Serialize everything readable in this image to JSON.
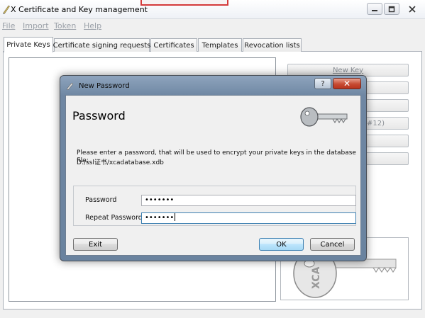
{
  "window": {
    "title": "X Certificate and Key management"
  },
  "menu": [
    {
      "label": "File"
    },
    {
      "label": "Import"
    },
    {
      "label": "Token"
    },
    {
      "label": "Help"
    }
  ],
  "tabs": [
    {
      "label": "Private Keys",
      "active": true
    },
    {
      "label": "Certificate signing requests"
    },
    {
      "label": "Certificates"
    },
    {
      "label": "Templates"
    },
    {
      "label": "Revocation lists"
    }
  ],
  "side_panel": {
    "new_key_label": "New Key",
    "obscured_text": "#12)"
  },
  "dialog": {
    "title": "New Password",
    "help_label": "?",
    "close_label": "✕",
    "heading": "Password",
    "description": "Please enter a password, that will be used to encrypt your private keys in the database file:",
    "file_path": "D:/ssl证书/xcadatabase.xdb",
    "password_label": "Password",
    "password_value": "•••••••",
    "repeat_label": "Repeat Password",
    "repeat_value": "•••••••",
    "exit_label": "Exit",
    "ok_label": "OK",
    "cancel_label": "Cancel"
  },
  "colors": {
    "dialog_frame": "#6f87a3",
    "close_button": "#c74b32",
    "focus_border": "#3c7fb1"
  },
  "icons": {
    "app": "pen-icon",
    "dialog": "pen-icon",
    "header": "key-icon",
    "logo": "xca-key-logo"
  }
}
